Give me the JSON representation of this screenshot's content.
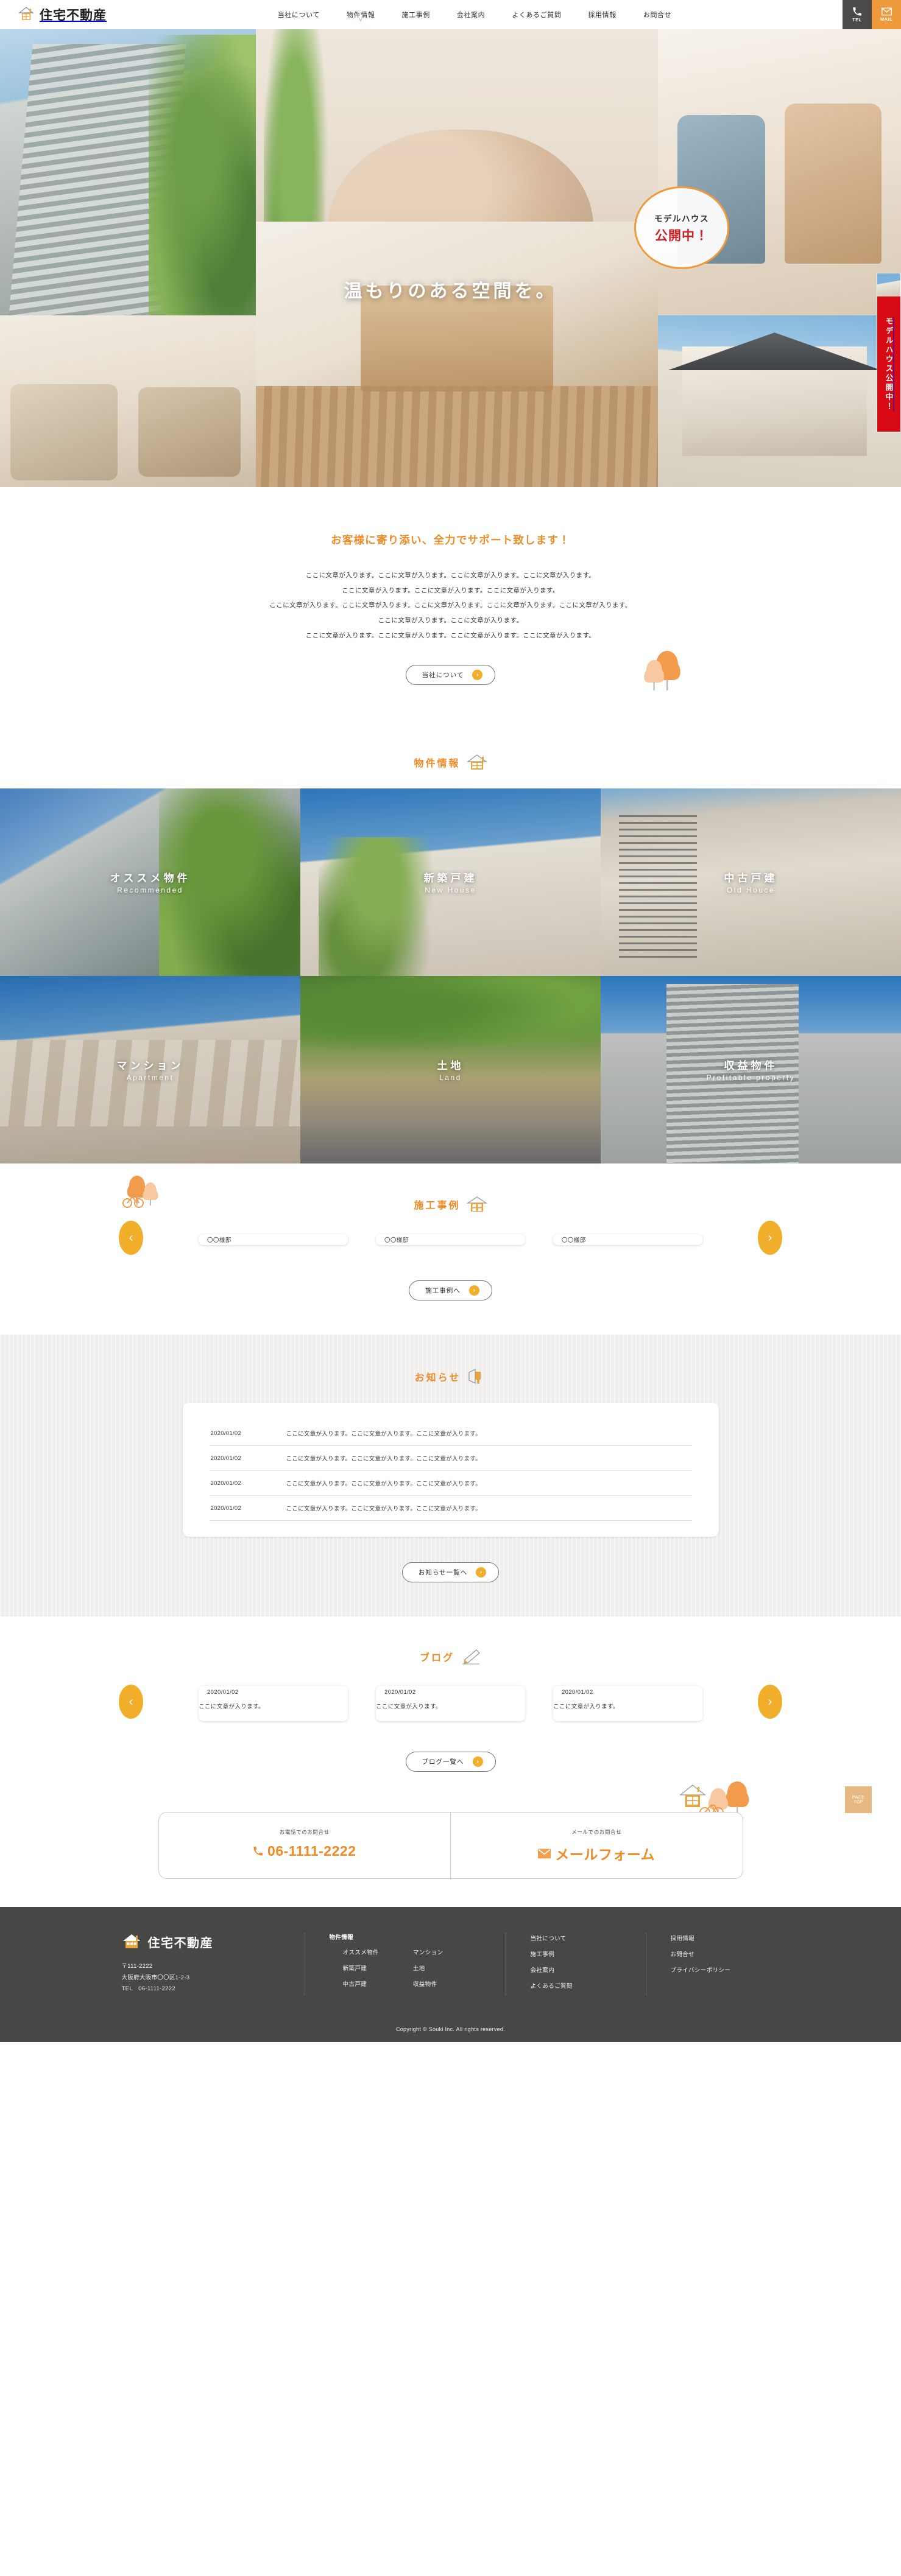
{
  "site": {
    "brand": "住宅不動産"
  },
  "header": {
    "nav": [
      {
        "label": "当社について",
        "has_caret": false
      },
      {
        "label": "物件情報",
        "has_caret": true
      },
      {
        "label": "施工事例",
        "has_caret": false
      },
      {
        "label": "会社案内",
        "has_caret": false
      },
      {
        "label": "よくあるご質問",
        "has_caret": false
      },
      {
        "label": "採用情報",
        "has_caret": false
      },
      {
        "label": "お問合せ",
        "has_caret": false
      }
    ],
    "tel_button": {
      "label": "TEL",
      "icon": "phone-icon"
    },
    "mail_button": {
      "label": "MAIL",
      "icon": "mail-icon"
    }
  },
  "hero": {
    "title": "温もりのある空間を。",
    "badge": {
      "line1": "モデルハウス",
      "line2": "公開中！"
    },
    "side_banner": {
      "text": "モデルハウス公開中！"
    }
  },
  "intro": {
    "heading": "お客様に寄り添い、全力でサポート致します！",
    "paragraphs": [
      "ここに文章が入ります。ここに文章が入ります。ここに文章が入ります。ここに文章が入ります。",
      "ここに文章が入ります。ここに文章が入ります。ここに文章が入ります。",
      "ここに文章が入ります。ここに文章が入ります。ここに文章が入ります。ここに文章が入ります。ここに文章が入ります。",
      "ここに文章が入ります。ここに文章が入ります。",
      "ここに文章が入ります。ここに文章が入ります。ここに文章が入ります。ここに文章が入ります。"
    ],
    "button": {
      "label": "当社について",
      "arrow": "›"
    }
  },
  "properties": {
    "heading": "物件情報",
    "heading_icon": "house-icon",
    "items": [
      {
        "jp": "オススメ物件",
        "en": "Recommended"
      },
      {
        "jp": "新築戸建",
        "en": "New House"
      },
      {
        "jp": "中古戸建",
        "en": "Old Houce"
      },
      {
        "jp": "マンション",
        "en": "Apartment"
      },
      {
        "jp": "土地",
        "en": "Land"
      },
      {
        "jp": "収益物件",
        "en": "Profitable property"
      }
    ]
  },
  "works": {
    "heading": "施工事例",
    "heading_icon": "house-window-icon",
    "prev_label": "‹",
    "next_label": "›",
    "cards": [
      {
        "caption": "〇〇様邸"
      },
      {
        "caption": "〇〇様邸"
      },
      {
        "caption": "〇〇様邸"
      }
    ],
    "button": {
      "label": "施工事例へ",
      "arrow": "›"
    }
  },
  "news": {
    "heading": "お知らせ",
    "heading_icon": "megaphone-icon",
    "rows": [
      {
        "date": "2020/01/02",
        "text": "ここに文章が入ります。ここに文章が入ります。ここに文章が入ります。"
      },
      {
        "date": "2020/01/02",
        "text": "ここに文章が入ります。ここに文章が入ります。ここに文章が入ります。"
      },
      {
        "date": "2020/01/02",
        "text": "ここに文章が入ります。ここに文章が入ります。ここに文章が入ります。"
      },
      {
        "date": "2020/01/02",
        "text": "ここに文章が入ります。ここに文章が入ります。ここに文章が入ります。"
      }
    ],
    "button": {
      "label": "お知らせ一覧へ",
      "arrow": "›"
    }
  },
  "blog": {
    "heading": "ブログ",
    "heading_icon": "pencil-icon",
    "prev_label": "‹",
    "next_label": "›",
    "cards": [
      {
        "date": "2020/01/02",
        "caption": "ここに文章が入ります。"
      },
      {
        "date": "2020/01/02",
        "caption": "ここに文章が入ります。"
      },
      {
        "date": "2020/01/02",
        "caption": "ここに文章が入ります。"
      }
    ],
    "button": {
      "label": "ブログ一覧へ",
      "arrow": "›"
    }
  },
  "contact": {
    "tel": {
      "small": "お電話でのお問合せ",
      "value": "06-1111-2222",
      "icon": "phone-icon"
    },
    "mail": {
      "small": "メールでのお問合せ",
      "value": "メールフォーム",
      "icon": "mail-icon"
    },
    "pagetop": {
      "line1": "PAGE",
      "line2": "TOP"
    }
  },
  "footer": {
    "brand": "住宅不動産",
    "postal": "〒111-2222",
    "address": "大阪府大阪市〇〇区1-2-3",
    "tel": "TEL　06-1111-2222",
    "col_property": {
      "head": "物件情報",
      "left": [
        "オススメ物件",
        "新築戸建",
        "中古戸建"
      ],
      "right": [
        "マンション",
        "土地",
        "収益物件"
      ]
    },
    "col_company": [
      "当社について",
      "施工事例",
      "会社案内",
      "よくあるご質問"
    ],
    "col_other": [
      "採用情報",
      "お問合せ",
      "プライバシーポリシー"
    ],
    "copyright": "Copyright © Souki Inc. All rights reserved."
  },
  "colors": {
    "accent_orange": "#f08c28",
    "button_yellow": "#f0ae2a",
    "header_dark": "#4a4a48",
    "footer_dark": "#474746",
    "banner_red": "#d80b15"
  }
}
